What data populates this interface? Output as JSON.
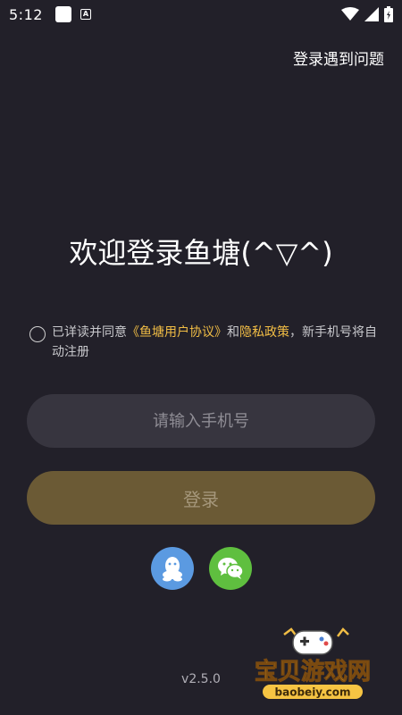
{
  "status_bar": {
    "time": "5:12",
    "icons": [
      "notification-square-icon",
      "app-a-icon",
      "wifi-icon",
      "signal-icon",
      "battery-icon"
    ]
  },
  "header": {
    "help_link": "登录遇到问题"
  },
  "main": {
    "welcome_title": "欢迎登录鱼塘(^▽^)",
    "agreement": {
      "prefix": "已详读并同意",
      "user_agreement": "《鱼塘用户协议》",
      "and": "和",
      "privacy_policy": "隐私政策",
      "suffix": "，新手机号将自动注册"
    },
    "phone_input": {
      "placeholder": "请输入手机号",
      "value": ""
    },
    "login_button": "登录",
    "social_login": [
      {
        "icon": "qq-icon",
        "color": "#5b9ae1"
      },
      {
        "icon": "wechat-icon",
        "color": "#5fbf3f"
      }
    ]
  },
  "footer": {
    "version": "v2.5.0"
  },
  "watermark": {
    "brand": "宝贝游戏网",
    "domain": "baobeiy.com"
  },
  "colors": {
    "background": "#222029",
    "accent": "#f1bd45",
    "input_bg": "#37353f",
    "login_bg": "#6b5a35"
  }
}
